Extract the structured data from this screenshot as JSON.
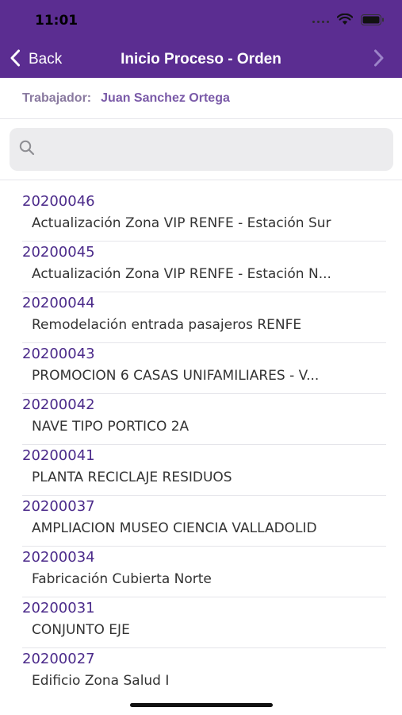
{
  "status_bar": {
    "time": "11:01"
  },
  "nav": {
    "back_label": "Back",
    "title": "Inicio Proceso - Orden"
  },
  "worker": {
    "label": "Trabajador:",
    "name": "Juan Sanchez Ortega"
  },
  "search": {
    "placeholder": ""
  },
  "colors": {
    "header_bg": "#5b2d91",
    "code_text": "#4b2a8a",
    "worker_name": "#7a5aa8"
  },
  "orders": [
    {
      "code": "20200046",
      "description": "Actualización Zona VIP RENFE - Estación Sur"
    },
    {
      "code": "20200045",
      "description": "Actualización Zona VIP RENFE - Estación N..."
    },
    {
      "code": "20200044",
      "description": "Remodelación entrada pasajeros RENFE"
    },
    {
      "code": "20200043",
      "description": "PROMOCION 6 CASAS UNIFAMILIARES - V..."
    },
    {
      "code": "20200042",
      "description": "NAVE TIPO PORTICO 2A"
    },
    {
      "code": "20200041",
      "description": "PLANTA RECICLAJE RESIDUOS"
    },
    {
      "code": "20200037",
      "description": "AMPLIACION MUSEO CIENCIA VALLADOLID"
    },
    {
      "code": "20200034",
      "description": "Fabricación Cubierta Norte"
    },
    {
      "code": "20200031",
      "description": "CONJUNTO EJE"
    },
    {
      "code": "20200027",
      "description": "Edificio Zona Salud I"
    }
  ]
}
